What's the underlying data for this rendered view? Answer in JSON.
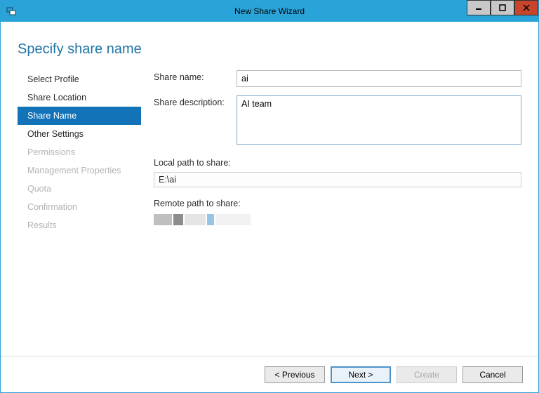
{
  "window": {
    "title": "New Share Wizard"
  },
  "heading": "Specify share name",
  "sidebar": {
    "items": [
      {
        "label": "Select Profile",
        "state": "enabled"
      },
      {
        "label": "Share Location",
        "state": "enabled"
      },
      {
        "label": "Share Name",
        "state": "selected"
      },
      {
        "label": "Other Settings",
        "state": "enabled"
      },
      {
        "label": "Permissions",
        "state": "disabled"
      },
      {
        "label": "Management Properties",
        "state": "disabled"
      },
      {
        "label": "Quota",
        "state": "disabled"
      },
      {
        "label": "Confirmation",
        "state": "disabled"
      },
      {
        "label": "Results",
        "state": "disabled"
      }
    ]
  },
  "form": {
    "share_name_label": "Share name:",
    "share_name_value": "ai",
    "share_desc_label": "Share description:",
    "share_desc_value": "AI team",
    "local_path_label": "Local path to share:",
    "local_path_value": "E:\\ai",
    "remote_path_label": "Remote path to share:"
  },
  "buttons": {
    "previous": "< Previous",
    "next": "Next >",
    "create": "Create",
    "cancel": "Cancel"
  }
}
